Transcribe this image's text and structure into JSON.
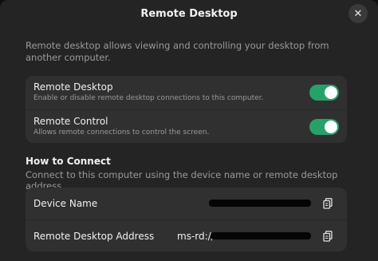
{
  "window": {
    "title": "Remote Desktop",
    "close_icon": "close-icon"
  },
  "intro": "Remote desktop allows viewing and controlling your desktop from another computer.",
  "toggles": [
    {
      "title": "Remote Desktop",
      "subtitle": "Enable or disable remote desktop connections to this computer.",
      "enabled": true
    },
    {
      "title": "Remote Control",
      "subtitle": "Allows remote connections to control the screen.",
      "enabled": true
    }
  ],
  "how_to_connect": {
    "title": "How to Connect",
    "subtitle": "Connect to this computer using the device name or remote desktop address.",
    "rows": [
      {
        "label": "Device Name",
        "value": "",
        "icon": "copy-icon"
      },
      {
        "label": "Remote Desktop Address",
        "value": "ms-rd://",
        "icon": "copy-icon"
      }
    ]
  },
  "colors": {
    "accent": "#26a269",
    "window_bg": "#242424",
    "card_bg": "#303030"
  }
}
